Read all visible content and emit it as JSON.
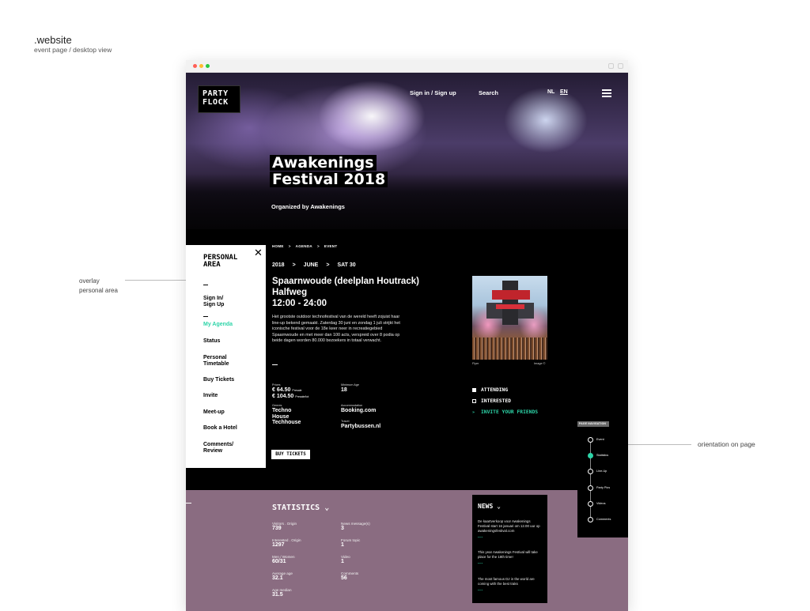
{
  "annotations": {
    "title": ".website",
    "subtitle": "event page / desktop view",
    "overlay_line1": "overlay",
    "overlay_line2": "personal area",
    "orientation": "orientation on page"
  },
  "header": {
    "logo_line1": "PARTY",
    "logo_line2": "FLOCK",
    "signin": "Sign in / Sign up",
    "search": "Search",
    "lang_nl": "NL",
    "lang_en": "EN"
  },
  "hero": {
    "title_line1": "Awakenings",
    "title_line2": "Festival 2018",
    "organized": "Organized by Awakenings"
  },
  "overlay": {
    "title_line1": "PERSONAL",
    "title_line2": "AREA",
    "close": "✕",
    "signin_line1": "Sign In/",
    "signin_line2": "Sign Up",
    "items": [
      "My Agenda",
      "Status",
      "Personal",
      "Timetable",
      "Buy Tickets",
      "Invite",
      "Meet-up",
      "Book a Hotel",
      "Comments/",
      "Review"
    ]
  },
  "breadcrumb": {
    "home": "HOME",
    "agenda": "AGENDA",
    "event": "EVENT",
    "sep": ">"
  },
  "event": {
    "year": "2018",
    "month": "JUNE",
    "day": "SAT 30",
    "sep": ">",
    "venue_line1": "Spaarnwoude (deelplan Houtrack)",
    "venue_line2": "Halfweg",
    "time": "12:00 - 24:00",
    "description": "Het grootste outdoor technofestival van de wereld heeft zojuist haar line-up bekend gemaakt. Zaterdag 30 juni en zondag 1 juli strijkt het iconische festival voor de 18e keer neer in recreatiegebied Spaarnwoude en met meer dan 100 acts, verspreid over 8 podia op beide dagen worden 80.000 bezoekers in totaal verwacht.",
    "prices_label": "Prices",
    "price1": "€  64.50",
    "price1_note": "Presale",
    "price2": "€ 104.50",
    "price2_note": "Presale/tot",
    "min_age_label": "Minimum Age",
    "min_age": "18",
    "genres_label": "Genres",
    "genres": [
      "Techno",
      "House",
      "Techhouse"
    ],
    "accommodation_label": "Accommodation",
    "accommodation": "Booking.com",
    "travel_label": "Travel",
    "travel": "Partybussen.nl",
    "buy_button": "BUY TICKETS",
    "flyer_caption": "Flyer",
    "image_caption": "Image ©"
  },
  "actions": {
    "attending": "ATTENDING",
    "interested": "INTERESTED",
    "invite": "INVITE YOUR FRIENDS",
    "invite_icon": "»"
  },
  "statistics": {
    "title": "STATISTICS ⌄",
    "left": [
      {
        "label": "Visitors . Origin",
        "value": "739"
      },
      {
        "label": "Interested . Origin",
        "value": "1297"
      },
      {
        "label": "Men / Women",
        "value": "60/31"
      },
      {
        "label": "Average age",
        "value": "32.1"
      },
      {
        "label": "Age median",
        "value": "31.5"
      }
    ],
    "right": [
      {
        "label": "News message(s)",
        "value": "3"
      },
      {
        "label": "Forum topic",
        "value": "1"
      },
      {
        "label": "Video",
        "value": "1"
      },
      {
        "label": "Comments",
        "value": "56"
      }
    ]
  },
  "news": {
    "title": "NEWS ⌄",
    "items": [
      "De kaartverkoop voor Awakenings Festival start 16 januari om 12.00 uur op awakeningsfestival.com",
      "This year Awakenings Festival will take place for the 18th time!",
      "The most famous DJ in the world are coming with the best traks"
    ],
    "more": "..."
  },
  "page_navigation": {
    "title": "PAGE NAVIGATION",
    "items": [
      "Event",
      "Statistics",
      "Line-Up",
      "Party Pics",
      "Videos",
      "Comments"
    ]
  },
  "colors": {
    "accent": "#2dd4a8",
    "stats_bg": "#8a6c81"
  }
}
